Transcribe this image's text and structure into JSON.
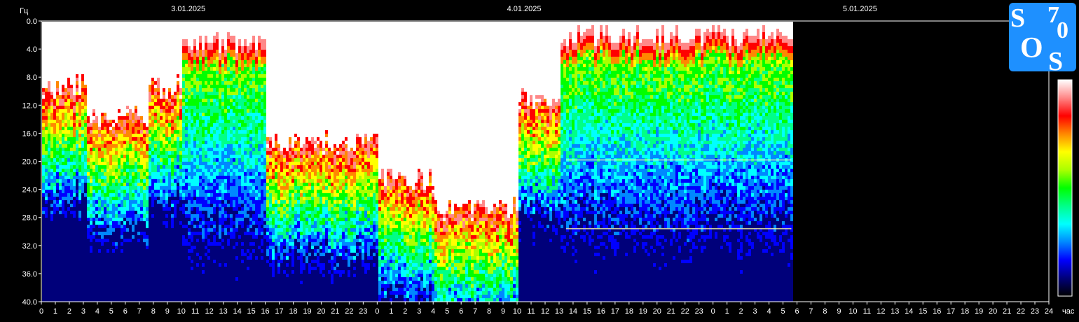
{
  "chart_data": {
    "type": "heatmap",
    "y_unit": "Гц",
    "x_unit": "час",
    "y_ticks": [
      "0.0",
      "4.0",
      "8.0",
      "12.0",
      "16.0",
      "20.0",
      "24.0",
      "28.0",
      "32.0",
      "36.0",
      "40.0"
    ],
    "ylim": [
      0,
      40
    ],
    "dates": [
      "3.01.2025",
      "4.01.2025",
      "5.01.2025"
    ],
    "x_ticks": [
      "0",
      "1",
      "2",
      "3",
      "4",
      "5",
      "6",
      "7",
      "8",
      "9",
      "10",
      "11",
      "12",
      "13",
      "14",
      "15",
      "16",
      "17",
      "18",
      "19",
      "20",
      "21",
      "22",
      "23",
      "0",
      "1",
      "2",
      "3",
      "4",
      "5",
      "6",
      "7",
      "8",
      "9",
      "10",
      "11",
      "12",
      "13",
      "14",
      "15",
      "16",
      "17",
      "18",
      "19",
      "20",
      "21",
      "22",
      "23",
      "0",
      "1",
      "2",
      "3",
      "4",
      "5",
      "6",
      "7",
      "8",
      "9",
      "10",
      "11",
      "12",
      "13",
      "14",
      "15",
      "16",
      "17",
      "18",
      "19",
      "20",
      "21",
      "22",
      "23",
      "24"
    ],
    "data_end_hours": 53.6,
    "total_hours": 72,
    "resonance_bands_hz": [
      19.8,
      29.6
    ],
    "segments": [
      {
        "start_h": 0.0,
        "end_h": 3.1,
        "top_hz": 9,
        "mode": "white"
      },
      {
        "start_h": 3.1,
        "end_h": 7.5,
        "top_hz": 13,
        "mode": "white"
      },
      {
        "start_h": 7.5,
        "end_h": 10.0,
        "top_hz": 9,
        "mode": "white"
      },
      {
        "start_h": 10.0,
        "end_h": 16.0,
        "top_hz": 3,
        "mode": "green"
      },
      {
        "start_h": 16.0,
        "end_h": 24.0,
        "top_hz": 17,
        "mode": "white"
      },
      {
        "start_h": 24.0,
        "end_h": 28.0,
        "top_hz": 22,
        "mode": "white"
      },
      {
        "start_h": 28.0,
        "end_h": 34.0,
        "top_hz": 26,
        "mode": "white"
      },
      {
        "start_h": 34.0,
        "end_h": 37.0,
        "top_hz": 11,
        "mode": "white"
      },
      {
        "start_h": 37.0,
        "end_h": 39.0,
        "top_hz": 2,
        "mode": "green"
      },
      {
        "start_h": 39.0,
        "end_h": 53.6,
        "top_hz": 2,
        "mode": "green"
      }
    ],
    "colorbar": [
      "#000000",
      "#00007a",
      "#0000ff",
      "#0088ff",
      "#00ffff",
      "#00ff88",
      "#00ff00",
      "#aaff00",
      "#ffff00",
      "#ff8800",
      "#ff0000",
      "#ff8888",
      "#ffffff"
    ]
  },
  "logo": {
    "letters": [
      "S",
      "7",
      "0",
      "O",
      "S"
    ],
    "bg_color": "#1e90ff"
  }
}
